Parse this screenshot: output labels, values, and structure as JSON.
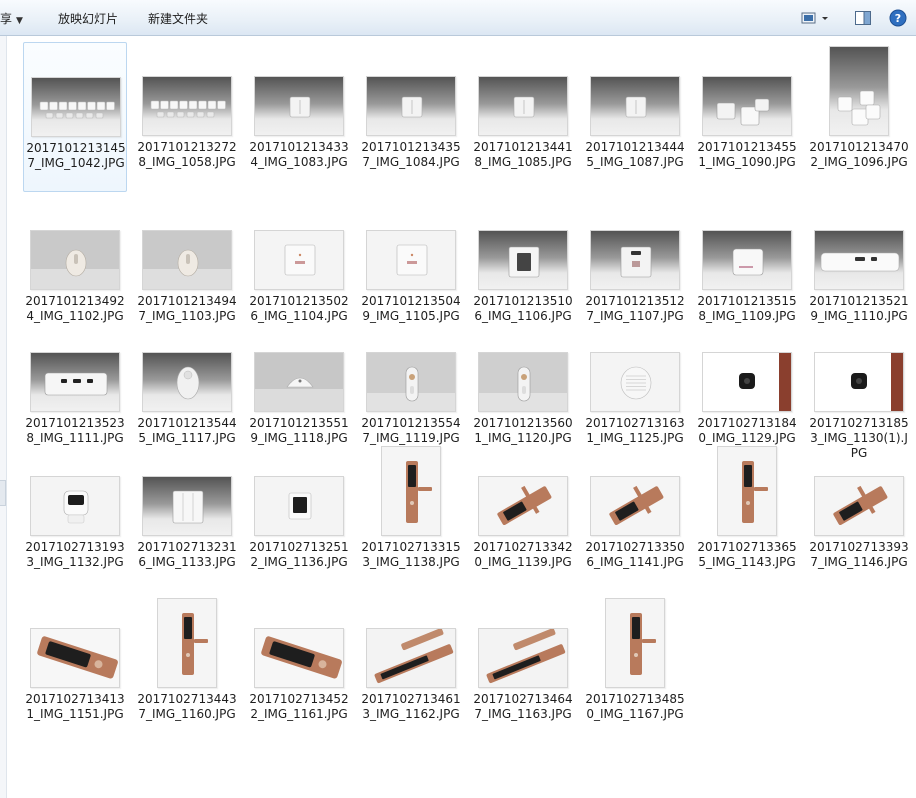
{
  "toolbar": {
    "share_label": "享",
    "slideshow_label": "放映幻灯片",
    "new_folder_label": "新建文件夹"
  },
  "files": [
    {
      "name": "20171012131457_IMG_1042.JPG",
      "kind": "switches-group",
      "orient": "land",
      "selected": true
    },
    {
      "name": "20171012132728_IMG_1058.JPG",
      "kind": "switches-group",
      "orient": "land"
    },
    {
      "name": "20171012134334_IMG_1083.JPG",
      "kind": "switch-single",
      "orient": "land"
    },
    {
      "name": "20171012134357_IMG_1084.JPG",
      "kind": "switch-single",
      "orient": "land"
    },
    {
      "name": "20171012134418_IMG_1085.JPG",
      "kind": "switch-single",
      "orient": "land"
    },
    {
      "name": "20171012134445_IMG_1087.JPG",
      "kind": "switch-single",
      "orient": "land"
    },
    {
      "name": "20171012134551_IMG_1090.JPG",
      "kind": "switches-three",
      "orient": "land"
    },
    {
      "name": "20171012134702_IMG_1096.JPG",
      "kind": "switches-stack",
      "orient": "port"
    },
    {
      "name": "20171012134924_IMG_1102.JPG",
      "kind": "sensor-oval",
      "orient": "land"
    },
    {
      "name": "20171012134947_IMG_1103.JPG",
      "kind": "sensor-oval",
      "orient": "land"
    },
    {
      "name": "20171012135026_IMG_1104.JPG",
      "kind": "socket",
      "orient": "land"
    },
    {
      "name": "20171012135049_IMG_1105.JPG",
      "kind": "socket",
      "orient": "land"
    },
    {
      "name": "20171012135106_IMG_1106.JPG",
      "kind": "socket-dark",
      "orient": "land"
    },
    {
      "name": "20171012135127_IMG_1107.JPG",
      "kind": "socket-usb",
      "orient": "land"
    },
    {
      "name": "20171012135158_IMG_1109.JPG",
      "kind": "gateway-box",
      "orient": "land"
    },
    {
      "name": "20171012135219_IMG_1110.JPG",
      "kind": "hub-flat",
      "orient": "land"
    },
    {
      "name": "20171012135238_IMG_1111.JPG",
      "kind": "hub-front",
      "orient": "land"
    },
    {
      "name": "20171012135445_IMG_1117.JPG",
      "kind": "motion-sensor",
      "orient": "land"
    },
    {
      "name": "20171012135519_IMG_1118.JPG",
      "kind": "dome-sensor",
      "orient": "land"
    },
    {
      "name": "20171012135547_IMG_1119.JPG",
      "kind": "remote",
      "orient": "land"
    },
    {
      "name": "20171012135601_IMG_1120.JPG",
      "kind": "remote",
      "orient": "land"
    },
    {
      "name": "20171027131631_IMG_1125.JPG",
      "kind": "speaker",
      "orient": "land"
    },
    {
      "name": "20171027131840_IMG_1129.JPG",
      "kind": "camera-black",
      "orient": "land"
    },
    {
      "name": "20171027131853_IMG_1130(1).JPG",
      "kind": "camera-black",
      "orient": "land"
    },
    {
      "name": "20171027131933_IMG_1132.JPG",
      "kind": "camera-cube",
      "orient": "land"
    },
    {
      "name": "20171027132316_IMG_1133.JPG",
      "kind": "panel-switch",
      "orient": "land"
    },
    {
      "name": "20171027132512_IMG_1136.JPG",
      "kind": "panel-screen",
      "orient": "land"
    },
    {
      "name": "20171027133153_IMG_1138.JPG",
      "kind": "lock-vertical",
      "orient": "port"
    },
    {
      "name": "20171027133420_IMG_1139.JPG",
      "kind": "lock-angled",
      "orient": "land"
    },
    {
      "name": "20171027133506_IMG_1141.JPG",
      "kind": "lock-angled",
      "orient": "land"
    },
    {
      "name": "20171027133655_IMG_1143.JPG",
      "kind": "lock-vertical",
      "orient": "port"
    },
    {
      "name": "20171027133937_IMG_1146.JPG",
      "kind": "lock-angled",
      "orient": "land"
    },
    {
      "name": "20171027134131_IMG_1151.JPG",
      "kind": "lock-side",
      "orient": "land"
    },
    {
      "name": "20171027134437_IMG_1160.JPG",
      "kind": "lock-vertical",
      "orient": "port"
    },
    {
      "name": "20171027134522_IMG_1161.JPG",
      "kind": "lock-side",
      "orient": "land"
    },
    {
      "name": "20171027134613_IMG_1162.JPG",
      "kind": "lock-handle",
      "orient": "land"
    },
    {
      "name": "20171027134647_IMG_1163.JPG",
      "kind": "lock-handle",
      "orient": "land"
    },
    {
      "name": "20171027134850_IMG_1167.JPG",
      "kind": "lock-vertical",
      "orient": "port"
    }
  ]
}
